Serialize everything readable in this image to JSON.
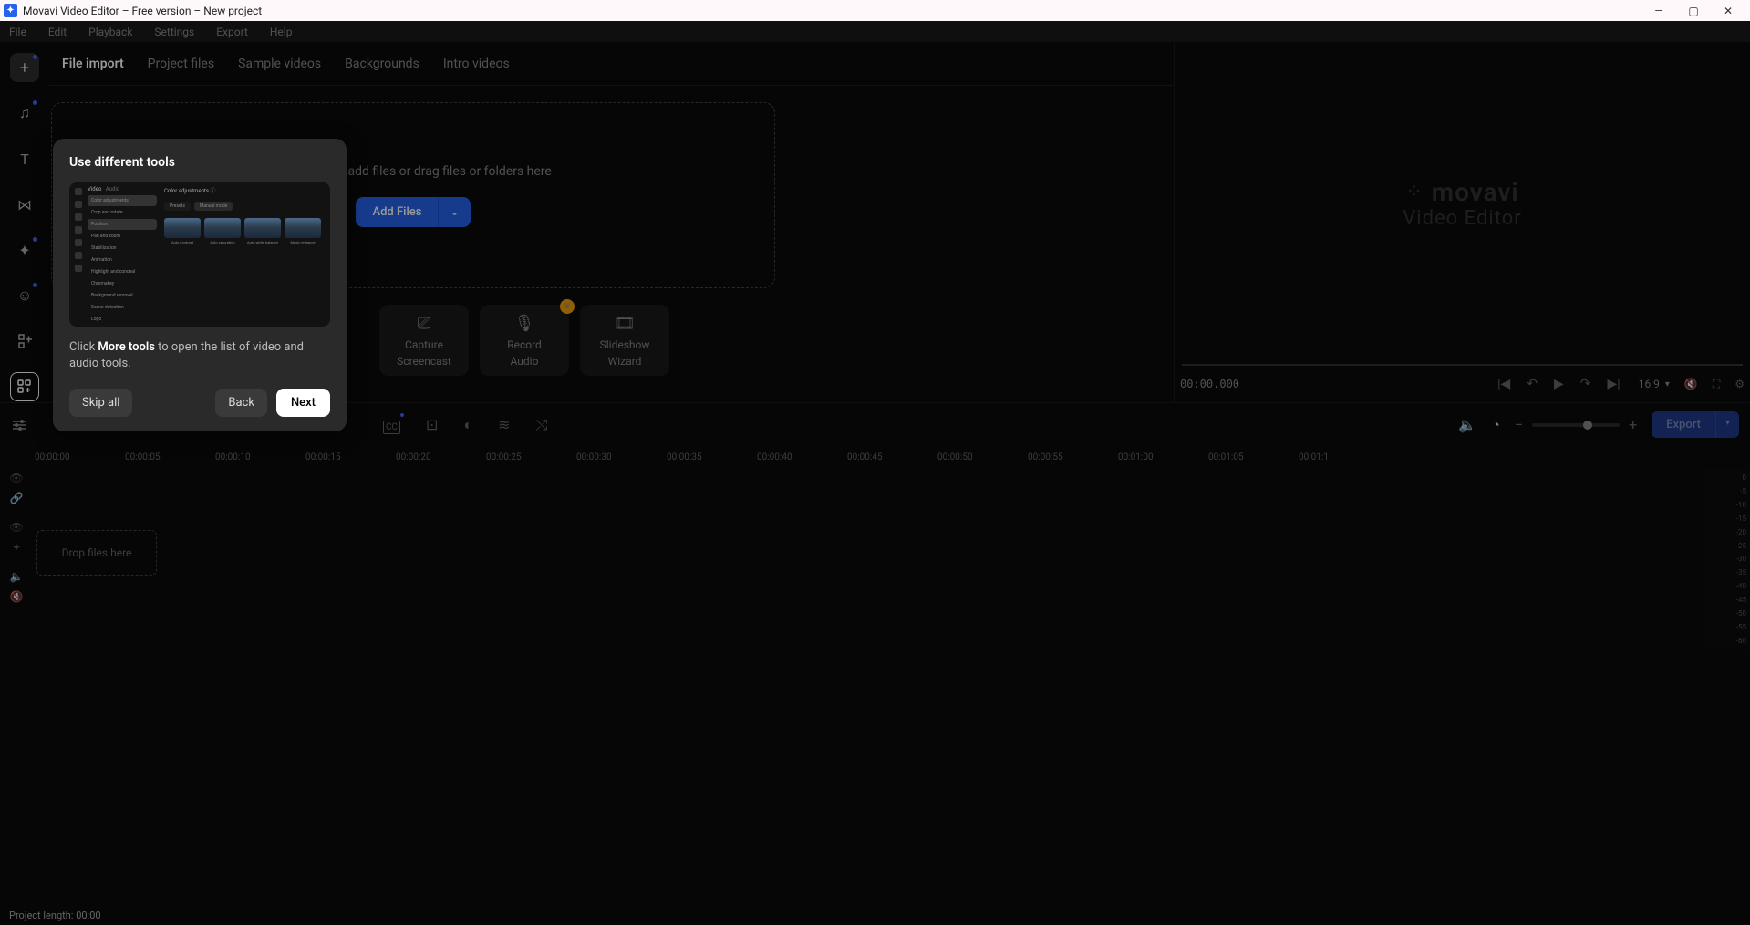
{
  "titlebar": {
    "app_name": "Movavi Video Editor – Free version – New project"
  },
  "menubar": [
    "File",
    "Edit",
    "Playback",
    "Settings",
    "Export",
    "Help"
  ],
  "sidebar_icons": [
    {
      "name": "plus-icon",
      "has_dot": true,
      "glyph": "+",
      "active": true
    },
    {
      "name": "music-icon",
      "has_dot": true,
      "glyph": "♫"
    },
    {
      "name": "text-icon",
      "has_dot": false,
      "glyph": "T"
    },
    {
      "name": "transition-icon",
      "has_dot": false,
      "glyph": "⋈"
    },
    {
      "name": "effects-icon",
      "has_dot": true,
      "glyph": "✦"
    },
    {
      "name": "stickers-icon",
      "has_dot": true,
      "glyph": "☺"
    },
    {
      "name": "elements-icon",
      "has_dot": false,
      "glyph": "▢₊"
    },
    {
      "name": "more-tools-icon",
      "has_dot": false,
      "glyph": "⊞₊",
      "highlight": true
    }
  ],
  "tabs": [
    {
      "label": "File import",
      "active": true
    },
    {
      "label": "Project files",
      "active": false
    },
    {
      "label": "Sample videos",
      "active": false
    },
    {
      "label": "Backgrounds",
      "active": false
    },
    {
      "label": "Intro videos",
      "active": false
    }
  ],
  "drop_zone_text": "Click here to add files or drag files or folders here",
  "add_files_label": "Add Files",
  "action_cards": [
    {
      "label1": "Capture",
      "label2": "Screencast",
      "icon": "⎚"
    },
    {
      "label1": "Record",
      "label2": "Audio",
      "icon": "🎙",
      "crown": true
    },
    {
      "label1": "Slideshow",
      "label2": "Wizard",
      "icon": "🎞"
    }
  ],
  "brand": {
    "name": "movavi",
    "sub": "Video Editor"
  },
  "preview": {
    "time": "00:00.000",
    "aspect": "16:9"
  },
  "timeline_tools": [
    {
      "name": "cc-icon",
      "glyph": "CC",
      "dot": true
    },
    {
      "name": "crop-icon",
      "glyph": "⊡",
      "dot": false
    },
    {
      "name": "color-icon",
      "glyph": "◐",
      "dot": false
    },
    {
      "name": "adjust-icon",
      "glyph": "⚙",
      "dot": false
    },
    {
      "name": "shuffle-icon",
      "glyph": "⤭",
      "dot": false
    }
  ],
  "right_tools": [
    {
      "name": "speaker-icon",
      "glyph": "🔈"
    },
    {
      "name": "speed-icon",
      "glyph": "◔"
    }
  ],
  "export_label": "Export",
  "ruler_marks": [
    "00:00:00",
    "00:00:05",
    "00:00:10",
    "00:00:15",
    "00:00:20",
    "00:00:25",
    "00:00:30",
    "00:00:35",
    "00:00:40",
    "00:00:45",
    "00:00:50",
    "00:00:55",
    "00:01:00",
    "00:01:05",
    "00:01:1"
  ],
  "track_drop_text": "Drop files here",
  "meter_values": [
    "0",
    "-5",
    "-10",
    "-15",
    "-20",
    "-25",
    "-30",
    "-35",
    "-40",
    "-45",
    "-50",
    "-55",
    "-60"
  ],
  "status_text": "Project length: 00:00",
  "tooltip": {
    "title": "Use different tools",
    "desc_pre": "Click ",
    "desc_bold": "More tools",
    "desc_post": " to open the list of video and audio tools.",
    "skip": "Skip all",
    "back": "Back",
    "next": "Next",
    "img_tabs": [
      "Video",
      "Audio"
    ],
    "img_list": [
      "Color adjustments",
      "Crop and rotate",
      "Position",
      "Pan and zoom",
      "Stabilization",
      "Animation",
      "Highlight and conceal",
      "Chromakey",
      "Background removal",
      "Scene detection",
      "Logo"
    ],
    "img_right_title": "Color adjustments",
    "img_pills": [
      "Presets",
      "Manual mode"
    ],
    "img_thumbs": [
      "Auto contrast",
      "Auto saturation",
      "Auto white balance",
      "Magic enhance"
    ]
  }
}
